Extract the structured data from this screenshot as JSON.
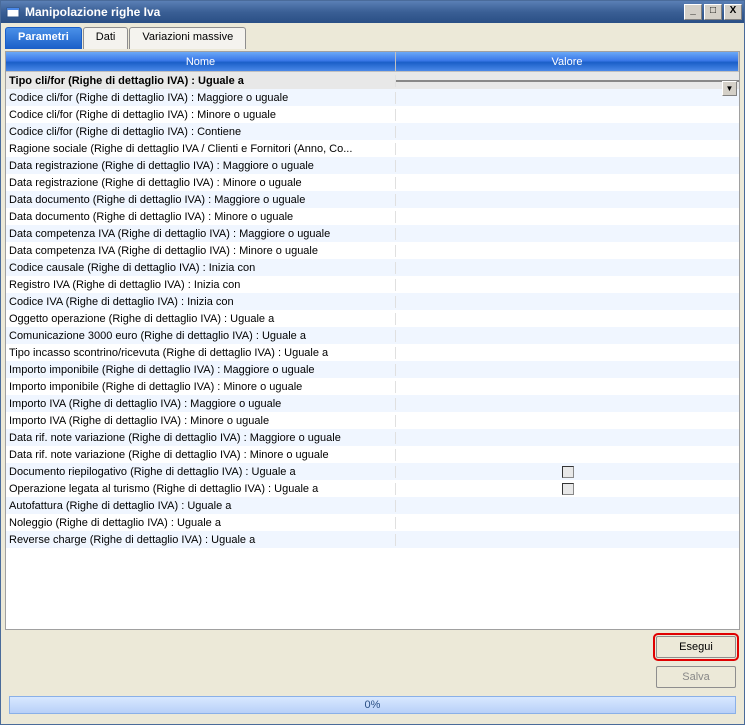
{
  "window": {
    "title": "Manipolazione righe Iva",
    "buttons": {
      "min": "_",
      "max": "□",
      "close": "X"
    }
  },
  "tabs": [
    "Parametri",
    "Dati",
    "Variazioni massive"
  ],
  "headers": {
    "name": "Nome",
    "value": "Valore"
  },
  "rows": [
    {
      "label": "Tipo cli/for (Righe di dettaglio IVA) : Uguale a",
      "selected": true,
      "dropdown": true
    },
    {
      "label": "Codice cli/for (Righe di dettaglio IVA) : Maggiore o uguale"
    },
    {
      "label": "Codice cli/for (Righe di dettaglio IVA) : Minore o uguale"
    },
    {
      "label": "Codice cli/for (Righe di dettaglio IVA) : Contiene"
    },
    {
      "label": "Ragione sociale (Righe di dettaglio IVA / Clienti e Fornitori (Anno, Co..."
    },
    {
      "label": "Data registrazione (Righe di dettaglio IVA) : Maggiore o uguale"
    },
    {
      "label": "Data registrazione (Righe di dettaglio IVA) : Minore o uguale"
    },
    {
      "label": "Data documento (Righe di dettaglio IVA) : Maggiore o uguale"
    },
    {
      "label": "Data documento (Righe di dettaglio IVA) : Minore o uguale"
    },
    {
      "label": "Data competenza IVA (Righe di dettaglio IVA) : Maggiore o uguale"
    },
    {
      "label": "Data competenza IVA (Righe di dettaglio IVA) : Minore o uguale"
    },
    {
      "label": "Codice causale (Righe di dettaglio IVA) : Inizia con"
    },
    {
      "label": "Registro IVA (Righe di dettaglio IVA) : Inizia con"
    },
    {
      "label": "Codice IVA (Righe di dettaglio IVA) : Inizia con"
    },
    {
      "label": "Oggetto operazione (Righe di dettaglio IVA) : Uguale a"
    },
    {
      "label": "Comunicazione 3000 euro (Righe di dettaglio IVA) : Uguale a"
    },
    {
      "label": "Tipo incasso scontrino/ricevuta (Righe di dettaglio IVA) : Uguale a"
    },
    {
      "label": "Importo imponibile (Righe di dettaglio IVA) : Maggiore o uguale"
    },
    {
      "label": "Importo imponibile (Righe di dettaglio IVA) : Minore o uguale"
    },
    {
      "label": "Importo IVA (Righe di dettaglio IVA) : Maggiore o uguale"
    },
    {
      "label": "Importo IVA (Righe di dettaglio IVA) : Minore o uguale"
    },
    {
      "label": "Data rif. note variazione (Righe di dettaglio IVA) : Maggiore o uguale"
    },
    {
      "label": "Data rif. note variazione (Righe di dettaglio IVA) : Minore o uguale"
    },
    {
      "label": "Documento riepilogativo (Righe di dettaglio IVA) : Uguale a",
      "checkbox": true
    },
    {
      "label": "Operazione legata al turismo (Righe di dettaglio IVA) : Uguale a",
      "checkbox": true
    },
    {
      "label": "Autofattura (Righe di dettaglio IVA) : Uguale a"
    },
    {
      "label": "Noleggio (Righe di dettaglio IVA) : Uguale a"
    },
    {
      "label": "Reverse charge (Righe di dettaglio IVA) : Uguale a"
    }
  ],
  "buttons": {
    "esegui": "Esegui",
    "salva": "Salva"
  },
  "progress": "0%"
}
